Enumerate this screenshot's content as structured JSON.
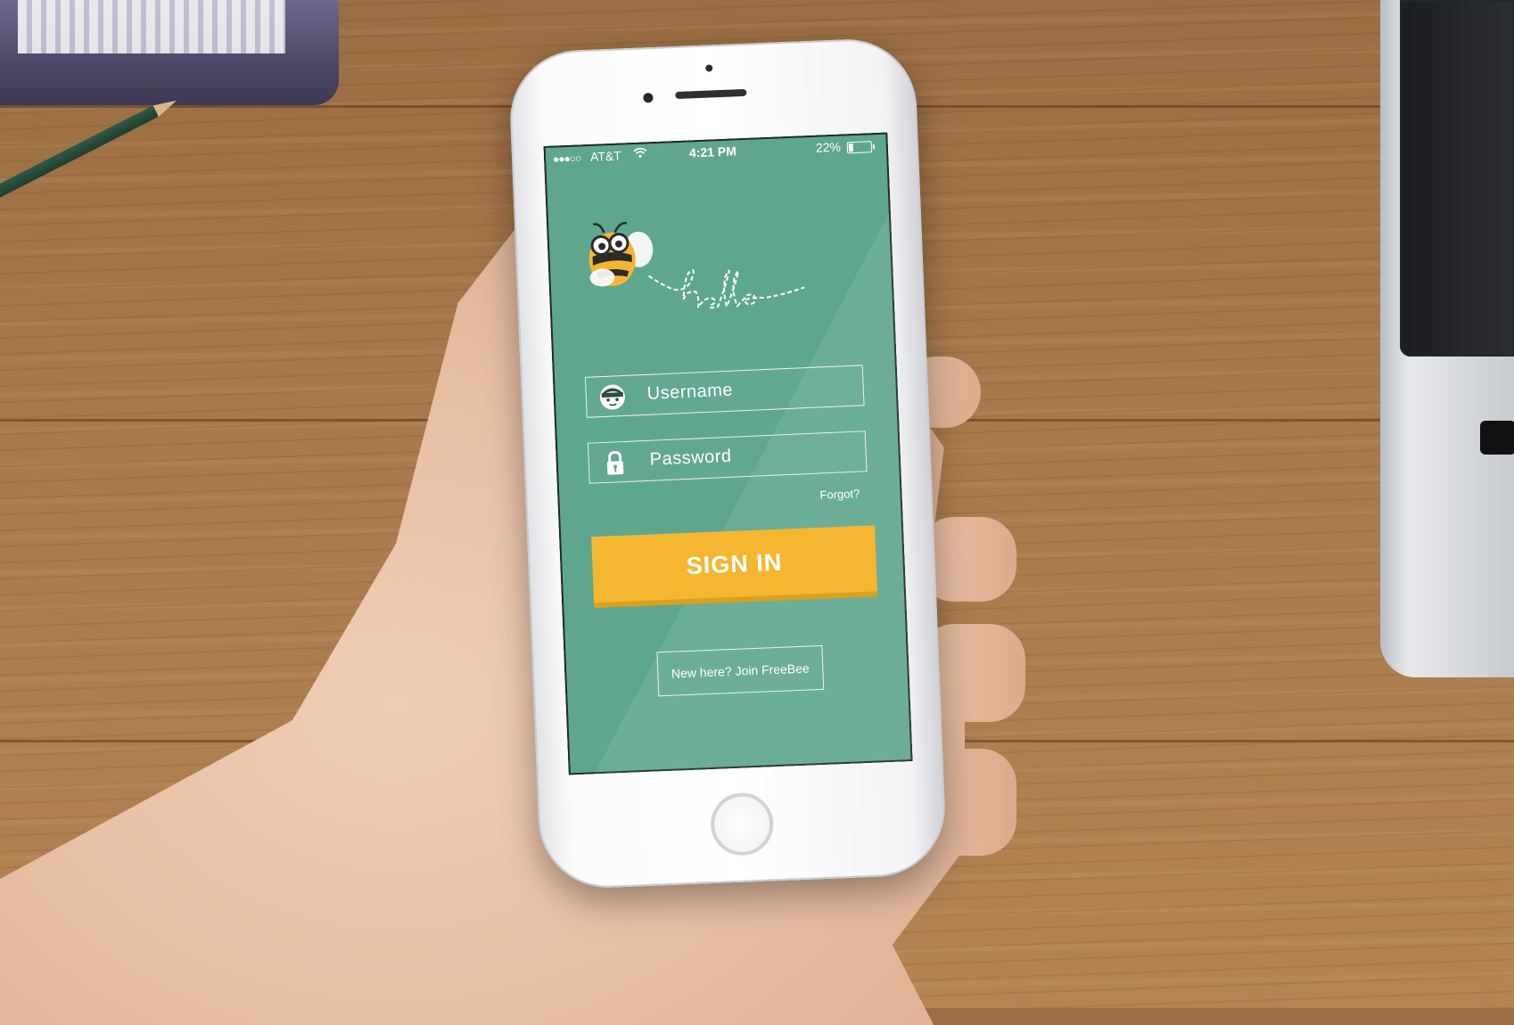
{
  "statusbar": {
    "signal": "●●●○○",
    "carrier": "AT&T",
    "wifi_icon": "wifi-icon",
    "time": "4:21 PM",
    "battery_percent": "22%"
  },
  "greeting": "hello",
  "login": {
    "username_placeholder": "Username",
    "password_placeholder": "Password",
    "forgot_label": "Forgot?",
    "signin_label": "SIGN IN",
    "join_label": "New here? Join FreeBee"
  },
  "colors": {
    "screen_background": "#5fa68f",
    "signin_button": "#f5b731",
    "text": "#ffffff"
  }
}
